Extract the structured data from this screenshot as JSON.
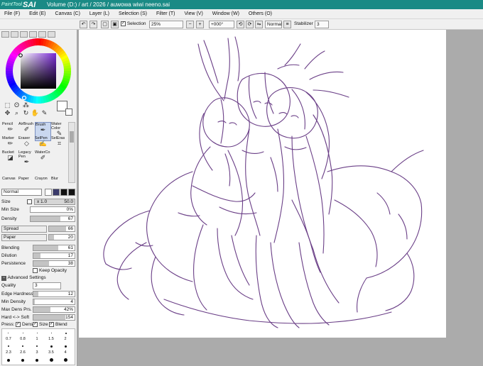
{
  "title_bar": {
    "logo_small": "PaintTool",
    "logo_main": "SAI",
    "document_path": "Volume (D:) / art / 2026 / auwowa wiwi neeno.sai"
  },
  "menu": [
    "File (F)",
    "Edit (E)",
    "Canvas (C)",
    "Layer (L)",
    "Selection (S)",
    "Filter (T)",
    "View (V)",
    "Window (W)",
    "Others (O)"
  ],
  "toolbar": {
    "selection_label": "Selection",
    "selection_checked": "✓",
    "zoom": "25%",
    "rotation": "+000°",
    "blend_mode": "Normal",
    "stabilizer_label": "Stabilizer",
    "stabilizer_value": "3"
  },
  "color_wheel": {
    "current_color": "#6a2d8a"
  },
  "tools": [
    {
      "label": "Pencil",
      "icon": "pencil-icon"
    },
    {
      "label": "AirBrush",
      "icon": "airbrush-icon"
    },
    {
      "label": "Brush",
      "icon": "brush-icon"
    },
    {
      "label": "Water Color",
      "icon": "watercolor-icon"
    },
    {
      "label": "Marker",
      "icon": "marker-icon"
    },
    {
      "label": "Eraser",
      "icon": "eraser-icon"
    },
    {
      "label": "SelPen",
      "icon": "selpen-icon"
    },
    {
      "label": "SelEras",
      "icon": "seleras-icon"
    },
    {
      "label": "Bucket",
      "icon": "bucket-icon"
    },
    {
      "label": "Legacy Pen",
      "icon": "legacy-pen-icon"
    },
    {
      "label": "WaterCo",
      "icon": "waterco-icon"
    }
  ],
  "tools_row2": [
    "Canvas",
    "Paper",
    "Crayon",
    "Blur"
  ],
  "brush": {
    "mode": "Normal",
    "size_label": "Size",
    "size_mult": "x 1.0",
    "size_value": "50.0",
    "min_size_label": "Min Size",
    "min_size_value": "0%",
    "density_label": "Density",
    "density_value": "67",
    "spread_label": "Spread",
    "spread_value": "66",
    "paper_label": "Paper",
    "paper_value": "20",
    "blending_label": "Blending",
    "blending_value": "61",
    "dilution_label": "Dilution",
    "dilution_value": "17",
    "persistence_label": "Persistence",
    "persistence_value": "38",
    "keep_opacity_label": "Keep Opacity"
  },
  "advanced": {
    "header": "Advanced Settings",
    "quality_label": "Quality",
    "quality_value": "3",
    "edge_label": "Edge Hardness",
    "edge_value": "12",
    "min_density_label": "Min Density",
    "min_density_value": "4",
    "max_dens_label": "Max Dens Prs.",
    "max_dens_value": "42%",
    "hard_soft_label": "Hard <-> Soft",
    "hard_soft_value": "154",
    "press_label": "Press:",
    "press_dens": "Dens",
    "press_size": "Size",
    "press_blend": "Blend"
  },
  "brush_sizes_row1": [
    "0.7",
    "0.8",
    "1",
    "1.5",
    "2"
  ],
  "brush_sizes_row2": [
    "2.3",
    "2.6",
    "3",
    "3.5",
    "4"
  ]
}
